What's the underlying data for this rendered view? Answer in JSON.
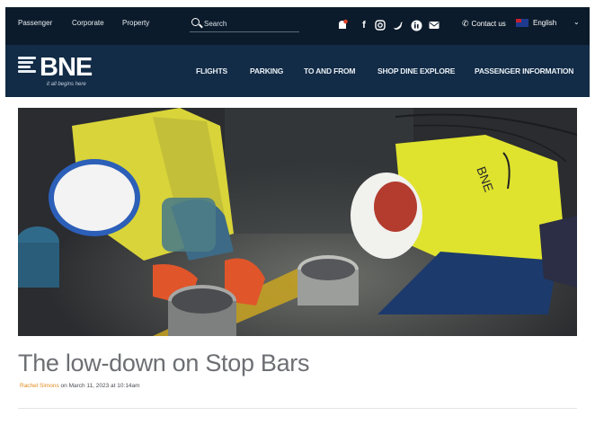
{
  "topbar": {
    "links": [
      "Passenger",
      "Corporate",
      "Property"
    ],
    "search_placeholder": "Search",
    "social_icons": [
      "notification-icon",
      "facebook-icon",
      "instagram-icon",
      "twitter-icon",
      "linkedin-icon",
      "email-icon"
    ],
    "contact_label": "Contact us",
    "language_label": "English"
  },
  "brand": {
    "logo_text": "BNE",
    "tagline": "it all begins here"
  },
  "nav": {
    "items": [
      "FLIGHTS",
      "PARKING",
      "TO AND FROM",
      "SHOP DINE EXPLORE",
      "PASSENGER INFORMATION"
    ]
  },
  "article": {
    "title": "The low-down on Stop Bars",
    "author": "Rachel Simons",
    "date_text": "on March 11, 2023 at 10:14am"
  },
  "colors": {
    "topbar_bg": "#0c1b2b",
    "navbar_bg": "#122b46",
    "author_accent": "#e08a1e",
    "title_text": "#6d6f73"
  }
}
